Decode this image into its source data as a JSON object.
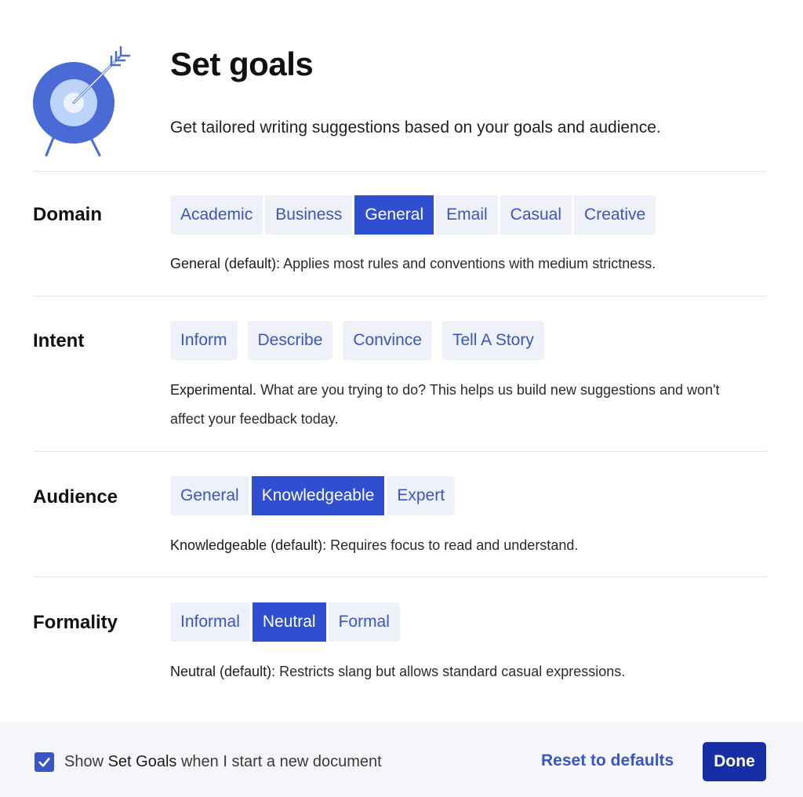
{
  "header": {
    "title": "Set goals",
    "subtitle": "Get tailored writing suggestions based on your goals and audience.",
    "icon": "target-icon"
  },
  "sections": {
    "domain": {
      "label": "Domain",
      "options": [
        "Academic",
        "Business",
        "General",
        "Email",
        "Casual",
        "Creative"
      ],
      "selected": "General",
      "desc_lead": "General (default):",
      "desc_text": " Applies most rules and conventions with medium strictness."
    },
    "intent": {
      "label": "Intent",
      "options": [
        "Inform",
        "Describe",
        "Convince",
        "Tell A Story"
      ],
      "desc_lead": "Experimental.",
      "desc_text": " What are you trying to do? This helps us build new suggestions and won't affect your feedback today."
    },
    "audience": {
      "label": "Audience",
      "options": [
        "General",
        "Knowledgeable",
        "Expert"
      ],
      "selected": "Knowledgeable",
      "desc_lead": "Knowledgeable (default):",
      "desc_text": " Requires focus to read and understand."
    },
    "formality": {
      "label": "Formality",
      "options": [
        "Informal",
        "Neutral",
        "Formal"
      ],
      "selected": "Neutral",
      "desc_lead": "Neutral (default):",
      "desc_text": " Restricts slang but allows standard casual expressions."
    }
  },
  "footer": {
    "checkbox_checked": true,
    "check_pre": "Show ",
    "check_strong": "Set Goals",
    "check_post": " when I start a new document",
    "reset_label": "Reset to defaults",
    "done_label": "Done"
  },
  "colors": {
    "accent": "#2f4fd0",
    "accent_dark": "#162ea3",
    "chip_bg": "#eef1f8",
    "chip_text": "#3a55c4",
    "footer_bg": "#f5f6f9"
  }
}
